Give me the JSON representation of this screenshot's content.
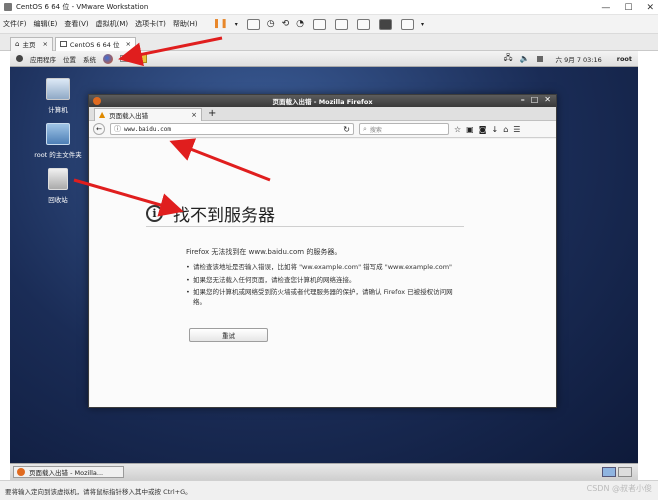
{
  "window": {
    "title": "CentOS 6 64 位 - VMware Workstation"
  },
  "menu": {
    "items": [
      "文件(F)",
      "编辑(E)",
      "查看(V)",
      "虚拟机(M)",
      "选项卡(T)",
      "帮助(H)"
    ]
  },
  "vm_tabs": [
    {
      "label": "主页"
    },
    {
      "label": "CentOS 6 64 位"
    }
  ],
  "gnome": {
    "apps": "应用程序",
    "places": "位置",
    "system": "系统",
    "clock": "六 9月 7 03:16",
    "user": "root"
  },
  "desktop": {
    "icons": [
      {
        "label": "计算机"
      },
      {
        "label": "root 的主文件夹"
      },
      {
        "label": "回收站"
      }
    ]
  },
  "firefox": {
    "title": "页面载入出错 - Mozilla Firefox",
    "tab_label": "页面载入出错",
    "url": "www.baidu.com",
    "search_placeholder": "搜索",
    "error": {
      "title": "找不到服务器",
      "desc": "Firefox 无法找到在 www.baidu.com 的服务器。",
      "bullets": [
        "请检查该地址是否输入错误，比如将 \"ww.example.com\" 错写成 \"www.example.com\"",
        "如果您无法载入任何页面，请检查您计算机的网络连接。",
        "如果您的计算机或网络受到防火墙或者代理服务器的保护，请确认 Firefox 已被授权访问网络。"
      ],
      "retry_label": "重试"
    }
  },
  "taskbar": {
    "item": "页面载入出错 - Mozilla..."
  },
  "status": {
    "text": "要将输入定向到该虚拟机，请将鼠标指针移入其中或按 Ctrl+G。"
  },
  "watermark": "CSDN @叔者小俊"
}
